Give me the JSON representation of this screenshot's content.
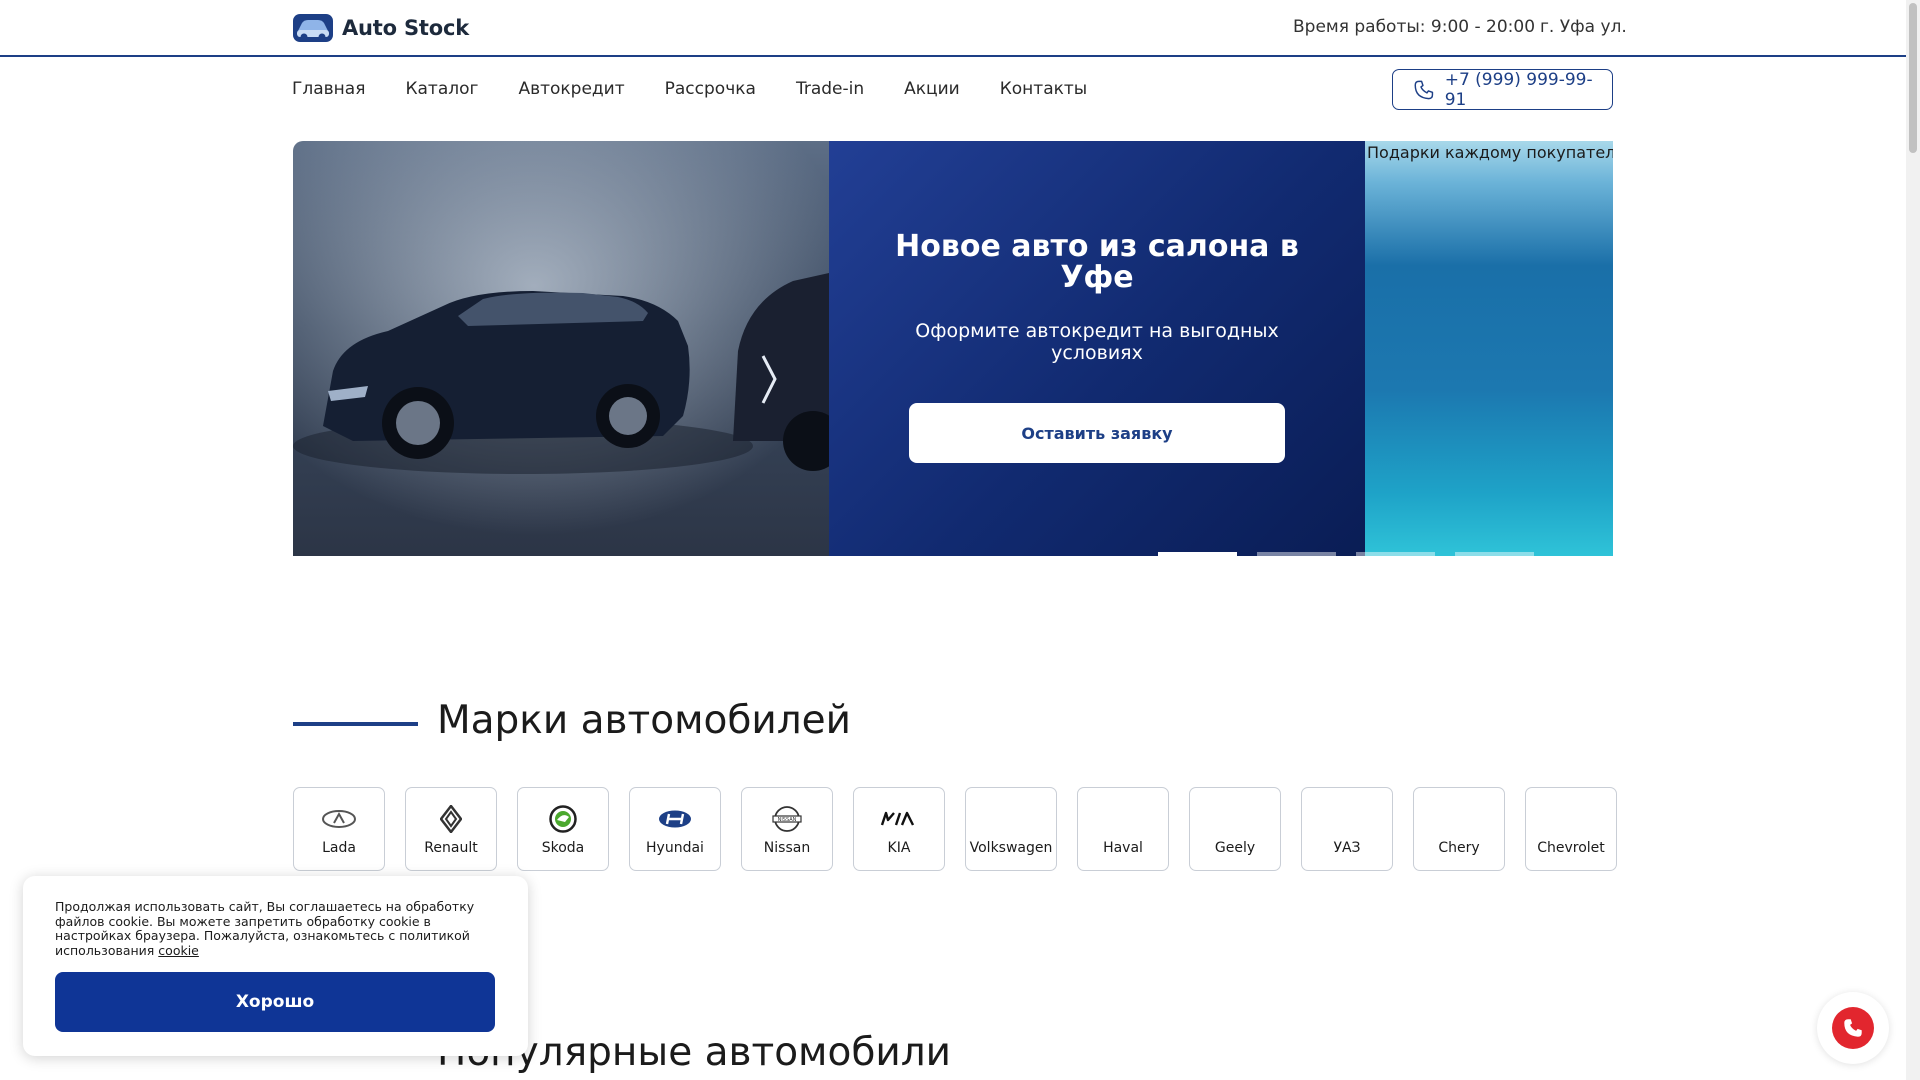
{
  "header": {
    "logo_text": "Auto Stock",
    "hours": "Время работы: 9:00 - 20:00",
    "city": "г. Уфа ул."
  },
  "nav": {
    "items": [
      "Главная",
      "Каталог",
      "Автокредит",
      "Рассрочка",
      "Trade-in",
      "Акции",
      "Контакты"
    ],
    "phone": "+7 (999) 999-99-91"
  },
  "hero": {
    "title": "Новое авто из салона в Уфе",
    "subtitle": "Оформите автокредит на выгодных условиях",
    "cta": "Оставить заявку",
    "next_slide_label": "Подарки каждому покупателю!",
    "dots_count": 4,
    "active_dot": 0
  },
  "brands": {
    "title": "Марки автомобилей",
    "items": [
      "Lada",
      "Renault",
      "Skoda",
      "Hyundai",
      "Nissan",
      "KIA",
      "Volkswagen",
      "Haval",
      "Geely",
      "УАЗ",
      "Chery",
      "Chevrolet"
    ]
  },
  "popular": {
    "title": "Популярные автомобили"
  },
  "cookie": {
    "text": "Продолжая использовать сайт, Вы соглашаетесь на обработку файлов cookie. Вы можете запретить обработку cookie в настройках браузера. Пожалуйста, ознакомьтесь с политикой использования",
    "link": "cookie",
    "button": "Хорошо"
  },
  "colors": {
    "brand_blue": "#1d3f86",
    "button_blue": "#0f3596",
    "call_red": "#e2262e"
  }
}
